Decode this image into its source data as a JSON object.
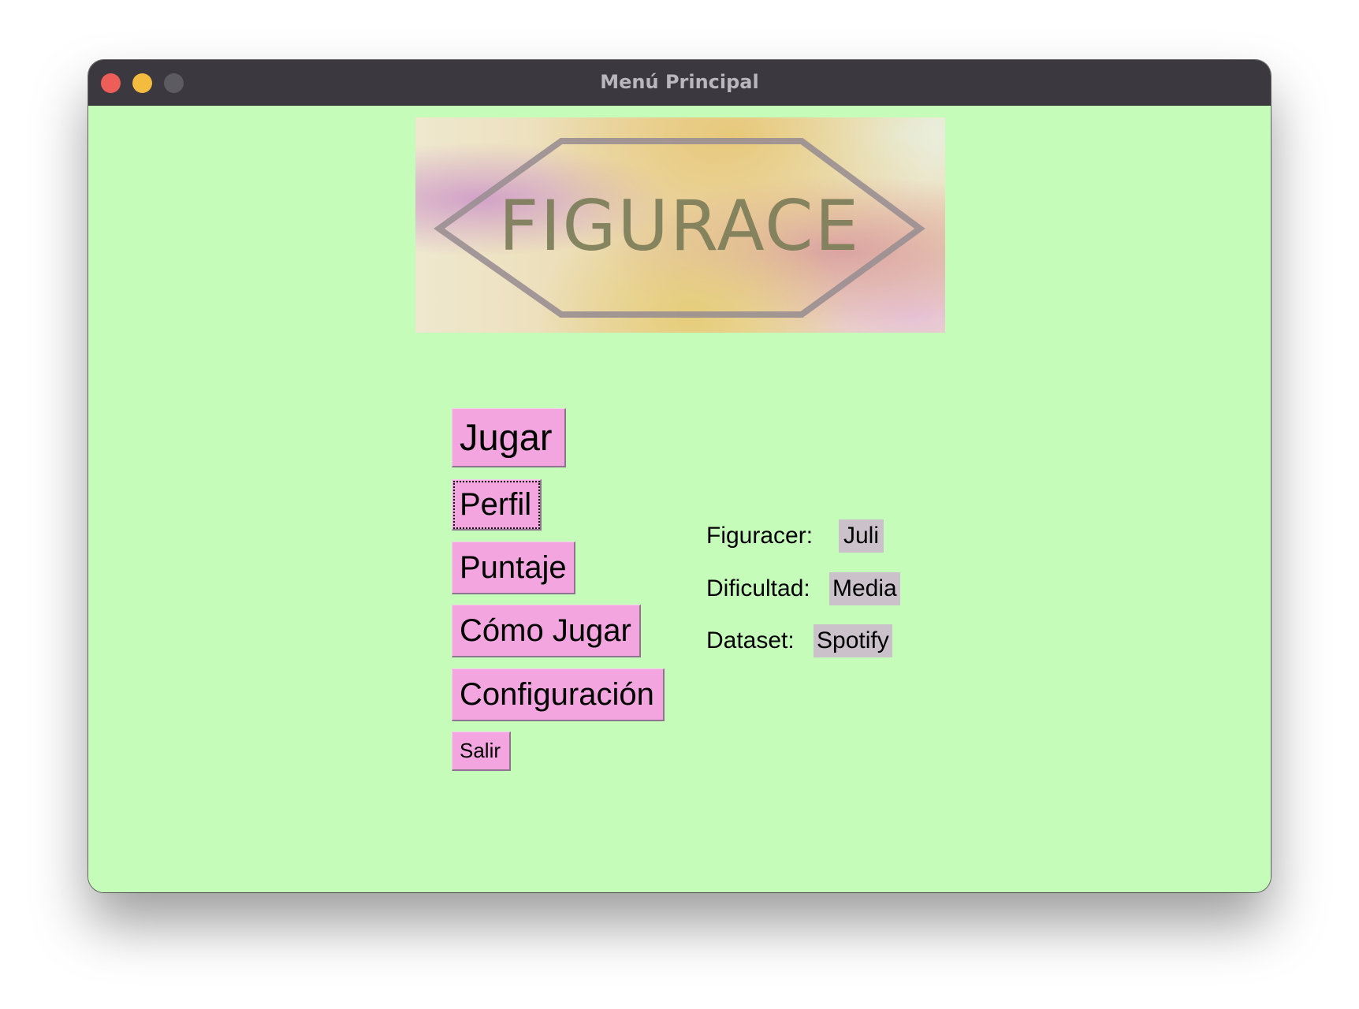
{
  "window": {
    "title": "Menú Principal"
  },
  "logo": {
    "text": "FIGURACE"
  },
  "menu": {
    "jugar": "Jugar",
    "perfil": "Perfil",
    "puntaje": "Puntaje",
    "como_jugar": "Cómo Jugar",
    "configuracion": "Configuración",
    "salir": "Salir"
  },
  "info": {
    "figuracer_label": "Figuracer:",
    "figuracer_value": "Juli",
    "dificultad_label": "Dificultad:",
    "dificultad_value": "Media",
    "dataset_label": "Dataset:",
    "dataset_value": "Spotify"
  },
  "colors": {
    "background": "#c6fcb9",
    "button": "#f2a5df",
    "value_box": "#cac1cb",
    "titlebar": "#3b3840"
  }
}
